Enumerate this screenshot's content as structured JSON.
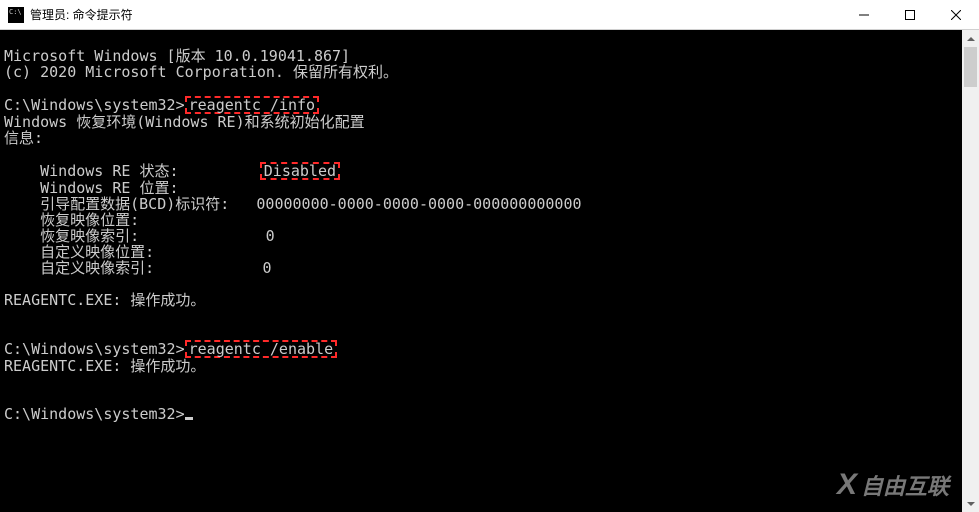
{
  "titlebar": {
    "title": "管理员: 命令提示符"
  },
  "terminal": {
    "line1": "Microsoft Windows [版本 10.0.19041.867]",
    "line2": "(c) 2020 Microsoft Corporation. 保留所有权利。",
    "prompt1_path": "C:\\Windows\\system32>",
    "cmd1": "reagentc /info",
    "line4": "Windows 恢复环境(Windows RE)和系统初始化配置",
    "line5": "信息:",
    "row1_label": "    Windows RE 状态:         ",
    "row1_value": "Disabled",
    "row2": "    Windows RE 位置:",
    "row3": "    引导配置数据(BCD)标识符:   00000000-0000-0000-0000-000000000000",
    "row4": "    恢复映像位置:",
    "row5": "    恢复映像索引:              0",
    "row6": "    自定义映像位置:",
    "row7": "    自定义映像索引:            0",
    "result1": "REAGENTC.EXE: 操作成功。",
    "prompt2_path": "C:\\Windows\\system32>",
    "cmd2": "reagentc /enable",
    "result2": "REAGENTC.EXE: 操作成功。",
    "prompt3_path": "C:\\Windows\\system32>"
  },
  "watermark": {
    "icon": "X",
    "text": "自由互联"
  }
}
